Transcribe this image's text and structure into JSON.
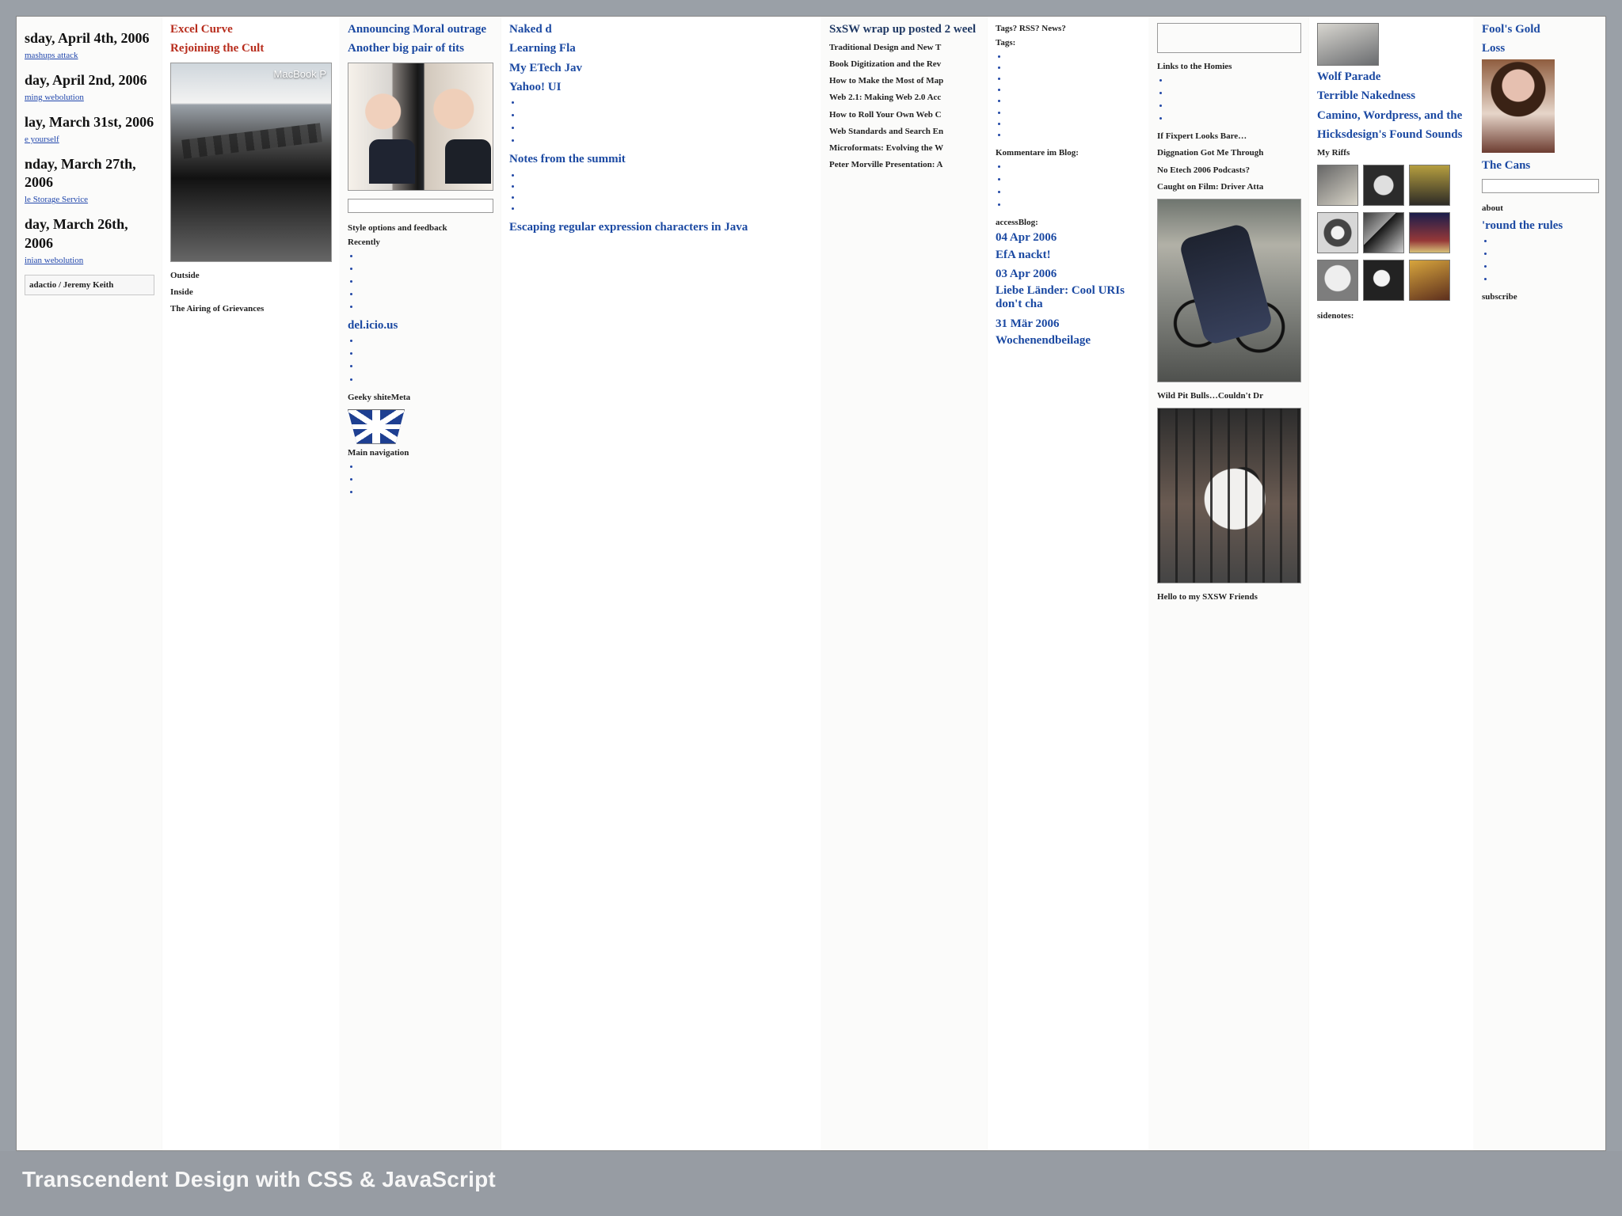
{
  "slide": {
    "footer_title": "Transcendent Design with CSS & JavaScript"
  },
  "columns": {
    "col1": {
      "title_1": "sday, April 4th, 2006",
      "link_1": "mashups attack",
      "title_2": "day, April 2nd, 2006",
      "link_2": "ming webolution",
      "title_3": "lay, March 31st, 2006",
      "link_3": "e yourself",
      "title_4": "nday, March 27th, 2006",
      "link_4": "le Storage Service",
      "title_5": "day, March 26th, 2006",
      "link_5": "inian webolution",
      "signature": "adactio / Jeremy Keith"
    },
    "col2": {
      "title_1": "Excel Curve",
      "title_2": "Rejoining the Cult",
      "photo_label": "MacBook P",
      "subhead_1": "Outside",
      "subhead_2": "Inside",
      "subhead_3": "The Airing of Grievances"
    },
    "col3": {
      "title_1": "Announcing Moral outrage",
      "title_2": "Another big pair of tits",
      "subhead_1": "Style options and feedback",
      "subhead_2": "Recently",
      "subhead_3": "del.icio.us",
      "subhead_4": "Geeky shiteMeta",
      "subhead_5": "Main navigation"
    },
    "col4": {
      "title_1": "Naked d",
      "title_2": "Learning Fla",
      "title_3": "My ETech Jav",
      "title_4": "Yahoo! UI",
      "title_5": "Notes from the summit",
      "title_6": "Escaping regular expression characters in Java"
    },
    "col5": {
      "title_1": "SxSW wrap up posted 2 weel",
      "subhead_1": "Traditional Design and New T",
      "subhead_2": "Book Digitization and the Rev",
      "subhead_3": "How to Make the Most of Map",
      "subhead_4": "Web 2.1: Making Web 2.0 Acc",
      "subhead_5": "How to Roll Your Own Web C",
      "subhead_6": "Web Standards and Search En",
      "subhead_7": "Microformats: Evolving the W",
      "subhead_8": "Peter Morville Presentation: A"
    },
    "col6": {
      "title_1": "Tags? RSS? News?",
      "title_2": "Tags:",
      "title_3": "Kommentare im Blog:",
      "title_4": "accessBlog:",
      "title_5": "04 Apr 2006",
      "title_6": "EfA nackt!",
      "title_7": "03 Apr 2006",
      "title_8": "Liebe Länder: Cool URIs don't cha",
      "title_9": "31 Mär 2006",
      "title_10": "Wochenendbeilage"
    },
    "col7": {
      "title_1": "Links to the Homies",
      "title_2": "If Fixpert Looks Bare…",
      "title_3": "Diggnation Got Me Through",
      "title_4": "No Etech 2006 Podcasts?",
      "title_5": "Caught on Film: Driver Atta",
      "title_6": "Wild Pit Bulls…Couldn't Dr",
      "title_7": "Hello to my SXSW Friends"
    },
    "col8": {
      "title_1": "Wolf Parade",
      "title_2": "Terrible Nakedness",
      "title_3": "Camino, Wordpress, and the",
      "title_4": "Hicksdesign's Found Sounds",
      "title_5": "My Riffs",
      "title_6": "sidenotes:"
    },
    "col9": {
      "title_1": "Fool's Gold",
      "title_2": "Loss",
      "title_3": "The Cans",
      "title_4": "about",
      "title_5": "'round the rules",
      "title_6": "subscribe"
    }
  },
  "colors": {
    "background": "#9aa0a7",
    "panel": "#d9d9d6",
    "link_blue": "#1f49a8",
    "title_red": "#b82d1d"
  }
}
